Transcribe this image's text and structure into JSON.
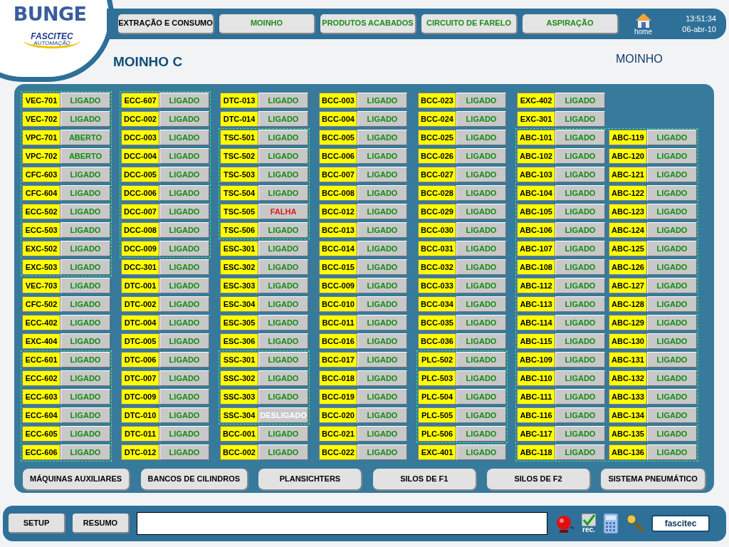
{
  "logo": {
    "brand": "BUNGE",
    "partner": "FASCITEC",
    "partner_sub": "AUTOMAÇÃO"
  },
  "nav": [
    {
      "label": "EXTRAÇÃO E CONSUMO",
      "active": true
    },
    {
      "label": "MOINHO",
      "active": false
    },
    {
      "label": "PRODUTOS ACABADOS",
      "active": false
    },
    {
      "label": "CIRCUITO DE FARELO",
      "active": false
    },
    {
      "label": "ASPIRAÇÃO",
      "active": false
    }
  ],
  "home_label": "home",
  "time": "13:51:34",
  "date": "06-abr-10",
  "title": "MOINHO C",
  "area": "MOINHO",
  "columns": [
    [
      {
        "grouped": true,
        "columns": [
          [
            {
              "tag": "VEC-701",
              "status": "LIGADO",
              "kind": "on"
            },
            {
              "tag": "VEC-702",
              "status": "LIGADO",
              "kind": "on"
            },
            {
              "tag": "VPC-701",
              "status": "ABERTO",
              "kind": "on"
            },
            {
              "tag": "VPC-702",
              "status": "ABERTO",
              "kind": "on"
            },
            {
              "tag": "CFC-603",
              "status": "LIGADO",
              "kind": "on"
            },
            {
              "tag": "CFC-604",
              "status": "LIGADO",
              "kind": "on"
            },
            {
              "tag": "ECC-502",
              "status": "LIGADO",
              "kind": "on"
            },
            {
              "tag": "ECC-503",
              "status": "LIGADO",
              "kind": "on"
            },
            {
              "tag": "EXC-502",
              "status": "LIGADO",
              "kind": "on"
            },
            {
              "tag": "EXC-503",
              "status": "LIGADO",
              "kind": "on"
            }
          ]
        ]
      },
      {
        "grouped": false,
        "columns": [
          [
            {
              "tag": "VEC-703",
              "status": "LIGADO",
              "kind": "on"
            },
            {
              "tag": "CFC-502",
              "status": "LIGADO",
              "kind": "on"
            },
            {
              "tag": "ECC-402",
              "status": "LIGADO",
              "kind": "on"
            },
            {
              "tag": "EXC-404",
              "status": "LIGADO",
              "kind": "on"
            }
          ]
        ]
      },
      {
        "grouped": true,
        "columns": [
          [
            {
              "tag": "ECC-601",
              "status": "LIGADO",
              "kind": "on"
            },
            {
              "tag": "ECC-602",
              "status": "LIGADO",
              "kind": "on"
            },
            {
              "tag": "ECC-603",
              "status": "LIGADO",
              "kind": "on"
            },
            {
              "tag": "ECC-604",
              "status": "LIGADO",
              "kind": "on"
            },
            {
              "tag": "ECC-605",
              "status": "LIGADO",
              "kind": "on"
            },
            {
              "tag": "ECC-606",
              "status": "LIGADO",
              "kind": "on"
            }
          ]
        ]
      }
    ],
    [
      {
        "grouped": true,
        "columns": [
          [
            {
              "tag": "ECC-607",
              "status": "LIGADO",
              "kind": "on"
            },
            {
              "tag": "DCC-002",
              "status": "LIGADO",
              "kind": "on"
            },
            {
              "tag": "DCC-003",
              "status": "LIGADO",
              "kind": "on"
            },
            {
              "tag": "DCC-004",
              "status": "LIGADO",
              "kind": "on"
            },
            {
              "tag": "DCC-005",
              "status": "LIGADO",
              "kind": "on"
            },
            {
              "tag": "DCC-006",
              "status": "LIGADO",
              "kind": "on"
            },
            {
              "tag": "DCC-007",
              "status": "LIGADO",
              "kind": "on"
            },
            {
              "tag": "DCC-008",
              "status": "LIGADO",
              "kind": "on"
            },
            {
              "tag": "DCC-009",
              "status": "LIGADO",
              "kind": "on"
            }
          ]
        ]
      },
      {
        "grouped": false,
        "columns": [
          [
            {
              "tag": "DCC-301",
              "status": "LIGADO",
              "kind": "on"
            },
            {
              "tag": "DTC-001",
              "status": "LIGADO",
              "kind": "on"
            },
            {
              "tag": "DTC-002",
              "status": "LIGADO",
              "kind": "on"
            },
            {
              "tag": "DTC-004",
              "status": "LIGADO",
              "kind": "on"
            },
            {
              "tag": "DTC-005",
              "status": "LIGADO",
              "kind": "on"
            },
            {
              "tag": "DTC-006",
              "status": "LIGADO",
              "kind": "on"
            },
            {
              "tag": "DTC-007",
              "status": "LIGADO",
              "kind": "on"
            },
            {
              "tag": "DTC-009",
              "status": "LIGADO",
              "kind": "on"
            },
            {
              "tag": "DTC-010",
              "status": "LIGADO",
              "kind": "on"
            },
            {
              "tag": "DTC-011",
              "status": "LIGADO",
              "kind": "on"
            },
            {
              "tag": "DTC-012",
              "status": "LIGADO",
              "kind": "on"
            }
          ]
        ]
      }
    ],
    [
      {
        "grouped": false,
        "columns": [
          [
            {
              "tag": "DTC-013",
              "status": "LIGADO",
              "kind": "on"
            },
            {
              "tag": "DTC-014",
              "status": "LIGADO",
              "kind": "on"
            }
          ]
        ]
      },
      {
        "grouped": true,
        "columns": [
          [
            {
              "tag": "TSC-501",
              "status": "LIGADO",
              "kind": "on"
            },
            {
              "tag": "TSC-502",
              "status": "LIGADO",
              "kind": "on"
            },
            {
              "tag": "TSC-503",
              "status": "LIGADO",
              "kind": "on"
            },
            {
              "tag": "TSC-504",
              "status": "LIGADO",
              "kind": "on"
            },
            {
              "tag": "TSC-505",
              "status": "FALHA",
              "kind": "fault"
            },
            {
              "tag": "TSC-506",
              "status": "LIGADO",
              "kind": "on"
            }
          ]
        ]
      },
      {
        "grouped": false,
        "columns": [
          [
            {
              "tag": "ESC-301",
              "status": "LIGADO",
              "kind": "on"
            },
            {
              "tag": "ESC-302",
              "status": "LIGADO",
              "kind": "on"
            },
            {
              "tag": "ESC-303",
              "status": "LIGADO",
              "kind": "on"
            },
            {
              "tag": "ESC-304",
              "status": "LIGADO",
              "kind": "on"
            },
            {
              "tag": "ESC-305",
              "status": "LIGADO",
              "kind": "on"
            },
            {
              "tag": "ESC-306",
              "status": "LIGADO",
              "kind": "on"
            }
          ]
        ]
      },
      {
        "grouped": true,
        "columns": [
          [
            {
              "tag": "SSC-301",
              "status": "LIGADO",
              "kind": "on"
            },
            {
              "tag": "SSC-302",
              "status": "LIGADO",
              "kind": "on"
            },
            {
              "tag": "SSC-303",
              "status": "LIGADO",
              "kind": "on"
            },
            {
              "tag": "SSC-304",
              "status": "DESLIGADO",
              "kind": "off"
            }
          ]
        ]
      },
      {
        "grouped": false,
        "columns": [
          [
            {
              "tag": "BCC-001",
              "status": "LIGADO",
              "kind": "on"
            },
            {
              "tag": "BCC-002",
              "status": "LIGADO",
              "kind": "on"
            }
          ]
        ]
      }
    ],
    [
      {
        "grouped": false,
        "columns": [
          [
            {
              "tag": "BCC-003",
              "status": "LIGADO",
              "kind": "on"
            },
            {
              "tag": "BCC-004",
              "status": "LIGADO",
              "kind": "on"
            },
            {
              "tag": "BCC-005",
              "status": "LIGADO",
              "kind": "on"
            },
            {
              "tag": "BCC-006",
              "status": "LIGADO",
              "kind": "on"
            },
            {
              "tag": "BCC-007",
              "status": "LIGADO",
              "kind": "on"
            },
            {
              "tag": "BCC-008",
              "status": "LIGADO",
              "kind": "on"
            },
            {
              "tag": "BCC-012",
              "status": "LIGADO",
              "kind": "on"
            },
            {
              "tag": "BCC-013",
              "status": "LIGADO",
              "kind": "on"
            },
            {
              "tag": "BCC-014",
              "status": "LIGADO",
              "kind": "on"
            },
            {
              "tag": "BCC-015",
              "status": "LIGADO",
              "kind": "on"
            },
            {
              "tag": "BCC-009",
              "status": "LIGADO",
              "kind": "on"
            },
            {
              "tag": "BCC-010",
              "status": "LIGADO",
              "kind": "on"
            },
            {
              "tag": "BCC-011",
              "status": "LIGADO",
              "kind": "on"
            },
            {
              "tag": "BCC-016",
              "status": "LIGADO",
              "kind": "on"
            },
            {
              "tag": "BCC-017",
              "status": "LIGADO",
              "kind": "on"
            },
            {
              "tag": "BCC-018",
              "status": "LIGADO",
              "kind": "on"
            },
            {
              "tag": "BCC-019",
              "status": "LIGADO",
              "kind": "on"
            },
            {
              "tag": "BCC-020",
              "status": "LIGADO",
              "kind": "on"
            },
            {
              "tag": "BCC-021",
              "status": "LIGADO",
              "kind": "on"
            },
            {
              "tag": "BCC-022",
              "status": "LIGADO",
              "kind": "on"
            }
          ]
        ]
      }
    ],
    [
      {
        "grouped": false,
        "columns": [
          [
            {
              "tag": "BCC-023",
              "status": "LIGADO",
              "kind": "on"
            },
            {
              "tag": "BCC-024",
              "status": "LIGADO",
              "kind": "on"
            },
            {
              "tag": "BCC-025",
              "status": "LIGADO",
              "kind": "on"
            },
            {
              "tag": "BCC-026",
              "status": "LIGADO",
              "kind": "on"
            },
            {
              "tag": "BCC-027",
              "status": "LIGADO",
              "kind": "on"
            },
            {
              "tag": "BCC-028",
              "status": "LIGADO",
              "kind": "on"
            },
            {
              "tag": "BCC-029",
              "status": "LIGADO",
              "kind": "on"
            },
            {
              "tag": "BCC-030",
              "status": "LIGADO",
              "kind": "on"
            },
            {
              "tag": "BCC-031",
              "status": "LIGADO",
              "kind": "on"
            },
            {
              "tag": "BCC-032",
              "status": "LIGADO",
              "kind": "on"
            },
            {
              "tag": "BCC-033",
              "status": "LIGADO",
              "kind": "on"
            },
            {
              "tag": "BCC-034",
              "status": "LIGADO",
              "kind": "on"
            },
            {
              "tag": "BCC-035",
              "status": "LIGADO",
              "kind": "on"
            },
            {
              "tag": "BCC-036",
              "status": "LIGADO",
              "kind": "on"
            }
          ]
        ]
      },
      {
        "grouped": true,
        "columns": [
          [
            {
              "tag": "PLC-502",
              "status": "LIGADO",
              "kind": "on"
            },
            {
              "tag": "PLC-503",
              "status": "LIGADO",
              "kind": "on"
            },
            {
              "tag": "PLC-504",
              "status": "LIGADO",
              "kind": "on"
            },
            {
              "tag": "PLC-505",
              "status": "LIGADO",
              "kind": "on"
            },
            {
              "tag": "PLC-506",
              "status": "LIGADO",
              "kind": "on"
            }
          ]
        ]
      },
      {
        "grouped": false,
        "columns": [
          [
            {
              "tag": "EXC-401",
              "status": "LIGADO",
              "kind": "on"
            }
          ]
        ]
      }
    ],
    [
      {
        "grouped": false,
        "columns": [
          [
            {
              "tag": "EXC-402",
              "status": "LIGADO",
              "kind": "on"
            },
            {
              "tag": "EXC-301",
              "status": "LIGADO",
              "kind": "on"
            }
          ]
        ]
      },
      {
        "grouped": true,
        "columns": [
          [
            {
              "tag": "ABC-101",
              "status": "LIGADO",
              "kind": "on"
            },
            {
              "tag": "ABC-102",
              "status": "LIGADO",
              "kind": "on"
            },
            {
              "tag": "ABC-103",
              "status": "LIGADO",
              "kind": "on"
            },
            {
              "tag": "ABC-104",
              "status": "LIGADO",
              "kind": "on"
            },
            {
              "tag": "ABC-105",
              "status": "LIGADO",
              "kind": "on"
            },
            {
              "tag": "ABC-106",
              "status": "LIGADO",
              "kind": "on"
            },
            {
              "tag": "ABC-107",
              "status": "LIGADO",
              "kind": "on"
            },
            {
              "tag": "ABC-108",
              "status": "LIGADO",
              "kind": "on"
            },
            {
              "tag": "ABC-112",
              "status": "LIGADO",
              "kind": "on"
            },
            {
              "tag": "ABC-113",
              "status": "LIGADO",
              "kind": "on"
            },
            {
              "tag": "ABC-114",
              "status": "LIGADO",
              "kind": "on"
            },
            {
              "tag": "ABC-115",
              "status": "LIGADO",
              "kind": "on"
            },
            {
              "tag": "ABC-109",
              "status": "LIGADO",
              "kind": "on"
            },
            {
              "tag": "ABC-110",
              "status": "LIGADO",
              "kind": "on"
            },
            {
              "tag": "ABC-111",
              "status": "LIGADO",
              "kind": "on"
            },
            {
              "tag": "ABC-116",
              "status": "LIGADO",
              "kind": "on"
            },
            {
              "tag": "ABC-117",
              "status": "LIGADO",
              "kind": "on"
            },
            {
              "tag": "ABC-118",
              "status": "LIGADO",
              "kind": "on"
            }
          ],
          [
            {
              "tag": "ABC-119",
              "status": "LIGADO",
              "kind": "on"
            },
            {
              "tag": "ABC-120",
              "status": "LIGADO",
              "kind": "on"
            },
            {
              "tag": "ABC-121",
              "status": "LIGADO",
              "kind": "on"
            },
            {
              "tag": "ABC-122",
              "status": "LIGADO",
              "kind": "on"
            },
            {
              "tag": "ABC-123",
              "status": "LIGADO",
              "kind": "on"
            },
            {
              "tag": "ABC-124",
              "status": "LIGADO",
              "kind": "on"
            },
            {
              "tag": "ABC-125",
              "status": "LIGADO",
              "kind": "on"
            },
            {
              "tag": "ABC-126",
              "status": "LIGADO",
              "kind": "on"
            },
            {
              "tag": "ABC-127",
              "status": "LIGADO",
              "kind": "on"
            },
            {
              "tag": "ABC-128",
              "status": "LIGADO",
              "kind": "on"
            },
            {
              "tag": "ABC-129",
              "status": "LIGADO",
              "kind": "on"
            },
            {
              "tag": "ABC-130",
              "status": "LIGADO",
              "kind": "on"
            },
            {
              "tag": "ABC-131",
              "status": "LIGADO",
              "kind": "on"
            },
            {
              "tag": "ABC-132",
              "status": "LIGADO",
              "kind": "on"
            },
            {
              "tag": "ABC-133",
              "status": "LIGADO",
              "kind": "on"
            },
            {
              "tag": "ABC-134",
              "status": "LIGADO",
              "kind": "on"
            },
            {
              "tag": "ABC-135",
              "status": "LIGADO",
              "kind": "on"
            },
            {
              "tag": "ABC-136",
              "status": "LIGADO",
              "kind": "on"
            }
          ]
        ]
      }
    ]
  ],
  "sections": [
    "MÁQUINAS AUXILIARES",
    "BANCOS DE CILINDROS",
    "PLANSICHTERS",
    "SILOS DE F1",
    "SILOS DE F2",
    "SISTEMA PNEUMÁTICO"
  ],
  "footer": {
    "buttons": [
      "SETUP",
      "RESUMO"
    ],
    "rec_label": "rec.",
    "user": "fascitec"
  }
}
